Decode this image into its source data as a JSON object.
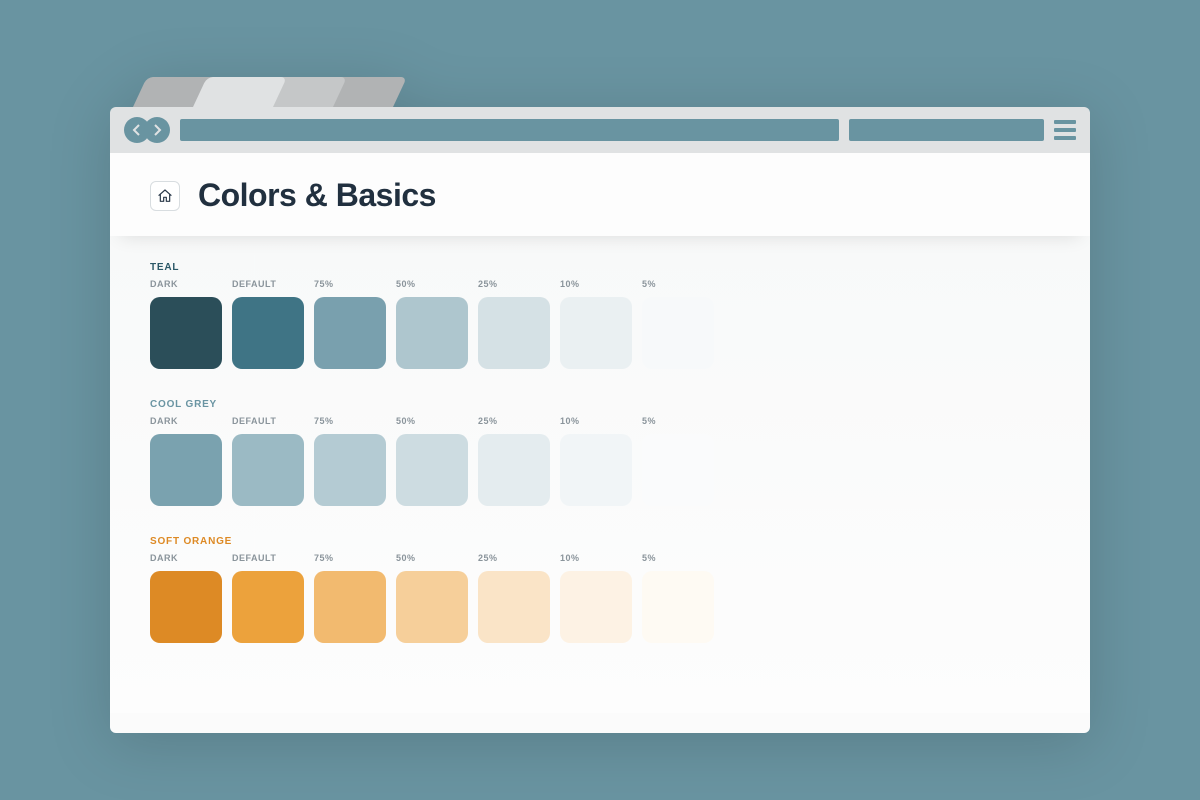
{
  "page": {
    "title": "Colors & Basics"
  },
  "tabs": {
    "colors": [
      "#b1b3b4",
      "#e0e2e3",
      "#c5c7c8",
      "#b1b3b4"
    ]
  },
  "swatch_labels": [
    "DARK",
    "DEFAULT",
    "75%",
    "50%",
    "25%",
    "10%",
    "5%"
  ],
  "palettes": [
    {
      "name": "TEAL",
      "accent": "#2b5867",
      "colors": [
        "#2b4e59",
        "#3f7485",
        "#79a0ae",
        "#aec6ce",
        "#d5e1e5",
        "#eaf0f2",
        "#f7f9fa"
      ]
    },
    {
      "name": "COOL GREY",
      "accent": "#6a94a2",
      "colors": [
        "#7aa2af",
        "#9bbac4",
        "#b4cbd3",
        "#cddce1",
        "#e4ecef",
        "#f1f5f7",
        "#fafbfc"
      ]
    },
    {
      "name": "SOFT ORANGE",
      "accent": "#dd8a25",
      "colors": [
        "#dd8a25",
        "#eca23c",
        "#f2ba6f",
        "#f6cf9a",
        "#fae4c7",
        "#fdf2e4",
        "#fefaf3"
      ]
    }
  ]
}
